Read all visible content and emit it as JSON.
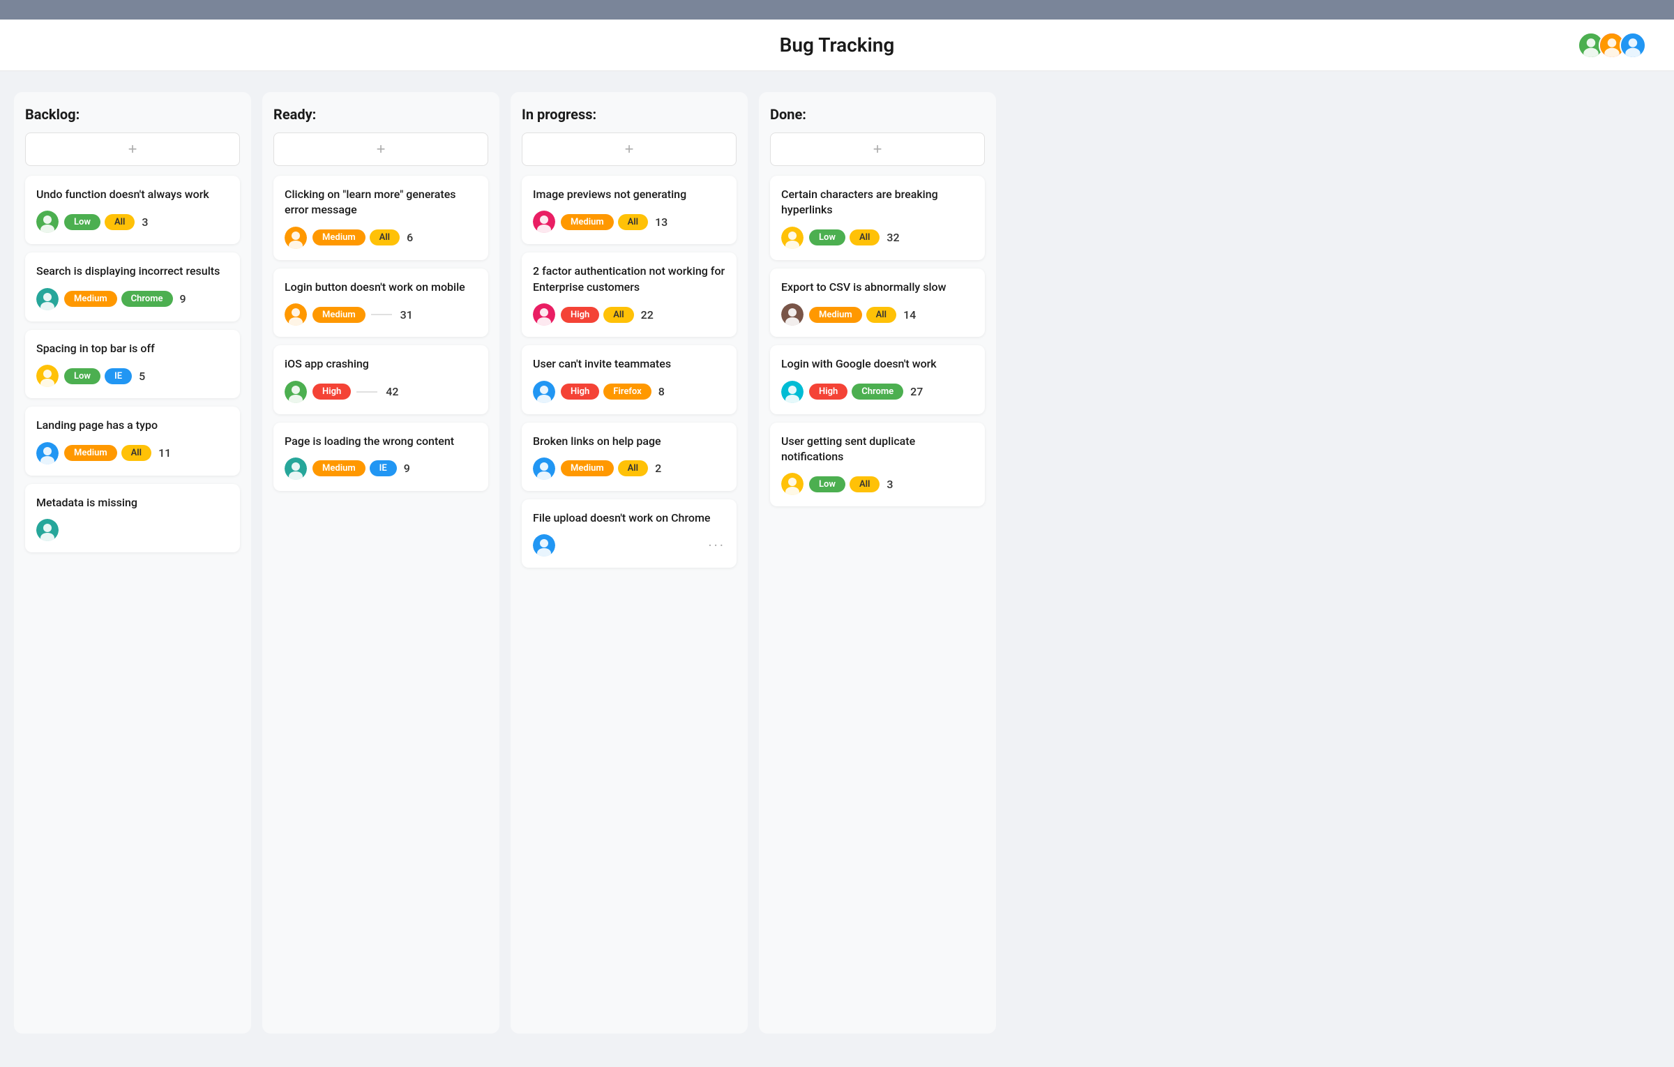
{
  "topBar": {},
  "header": {
    "title": "Bug Tracking",
    "avatars": [
      {
        "color": "#4caf50",
        "label": "user1",
        "emoji": "👩"
      },
      {
        "color": "#ff9800",
        "label": "user2",
        "emoji": "👱"
      },
      {
        "color": "#2196f3",
        "label": "user3",
        "emoji": "👦"
      }
    ]
  },
  "addButtonLabel": "+",
  "columns": [
    {
      "id": "backlog",
      "title": "Backlog:",
      "cards": [
        {
          "title": "Undo function doesn't always work",
          "avatarColor": "#4caf50",
          "avatarEmoji": "🧑",
          "priority": "Low",
          "priorityClass": "tag-low",
          "platform": "All",
          "platformClass": "tag-all",
          "count": "3"
        },
        {
          "title": "Search is displaying incorrect results",
          "avatarColor": "#26a69a",
          "avatarEmoji": "🧑",
          "priority": "Medium",
          "priorityClass": "tag-medium",
          "platform": "Chrome",
          "platformClass": "tag-chrome",
          "count": "9"
        },
        {
          "title": "Spacing in top bar is off",
          "avatarColor": "#ffc107",
          "avatarEmoji": "🧑",
          "priority": "Low",
          "priorityClass": "tag-low",
          "platform": "IE",
          "platformClass": "tag-ie",
          "count": "5"
        },
        {
          "title": "Landing page has a typo",
          "avatarColor": "#2196f3",
          "avatarEmoji": "🧑",
          "priority": "Medium",
          "priorityClass": "tag-medium",
          "platform": "All",
          "platformClass": "tag-all",
          "count": "11"
        },
        {
          "title": "Metadata is missing",
          "avatarColor": "#26a69a",
          "avatarEmoji": "🧑",
          "priority": null,
          "platform": null,
          "count": null
        }
      ]
    },
    {
      "id": "ready",
      "title": "Ready:",
      "cards": [
        {
          "title": "Clicking on \"learn more\" generates error message",
          "avatarColor": "#ff9800",
          "avatarEmoji": "🧑",
          "priority": "Medium",
          "priorityClass": "tag-medium",
          "platform": "All",
          "platformClass": "tag-all",
          "count": "6"
        },
        {
          "title": "Login button doesn't work on mobile",
          "avatarColor": "#ff9800",
          "avatarEmoji": "🧑",
          "priority": "Medium",
          "priorityClass": "tag-medium",
          "platform": null,
          "platformClass": null,
          "count": "31",
          "showDivider": true
        },
        {
          "title": "iOS app crashing",
          "avatarColor": "#4caf50",
          "avatarEmoji": "🧑",
          "priority": "High",
          "priorityClass": "tag-high",
          "platform": null,
          "platformClass": null,
          "count": "42",
          "showDivider": true
        },
        {
          "title": "Page is loading the wrong content",
          "avatarColor": "#26a69a",
          "avatarEmoji": "🧑",
          "priority": "Medium",
          "priorityClass": "tag-medium",
          "platform": "IE",
          "platformClass": "tag-ie",
          "count": "9"
        }
      ]
    },
    {
      "id": "inprogress",
      "title": "In progress:",
      "cards": [
        {
          "title": "Image previews not generating",
          "avatarColor": "#e91e63",
          "avatarEmoji": "🧑",
          "priority": "Medium",
          "priorityClass": "tag-medium",
          "platform": "All",
          "platformClass": "tag-all",
          "count": "13"
        },
        {
          "title": "2 factor authentication not working for Enterprise customers",
          "avatarColor": "#e91e63",
          "avatarEmoji": "🧑",
          "priority": "High",
          "priorityClass": "tag-high",
          "platform": "All",
          "platformClass": "tag-all",
          "count": "22"
        },
        {
          "title": "User can't invite teammates",
          "avatarColor": "#2196f3",
          "avatarEmoji": "🧑",
          "priority": "High",
          "priorityClass": "tag-high",
          "platform": "Firefox",
          "platformClass": "tag-firefox",
          "count": "8"
        },
        {
          "title": "Broken links on help page",
          "avatarColor": "#2196f3",
          "avatarEmoji": "🧑",
          "priority": "Medium",
          "priorityClass": "tag-medium",
          "platform": "All",
          "platformClass": "tag-all",
          "count": "2"
        },
        {
          "title": "File upload doesn't work on Chrome",
          "avatarColor": "#2196f3",
          "avatarEmoji": "🧑",
          "priority": null,
          "platform": null,
          "count": null,
          "showDots": true
        }
      ]
    },
    {
      "id": "done",
      "title": "Done:",
      "cards": [
        {
          "title": "Certain characters are breaking hyperlinks",
          "avatarColor": "#ffc107",
          "avatarEmoji": "🧑",
          "priority": "Low",
          "priorityClass": "tag-low",
          "platform": "All",
          "platformClass": "tag-all",
          "count": "32"
        },
        {
          "title": "Export to CSV is abnormally slow",
          "avatarColor": "#795548",
          "avatarEmoji": "🧑",
          "priority": "Medium",
          "priorityClass": "tag-medium",
          "platform": "All",
          "platformClass": "tag-all",
          "count": "14"
        },
        {
          "title": "Login with Google doesn't work",
          "avatarColor": "#00bcd4",
          "avatarEmoji": "🧑",
          "priority": "High",
          "priorityClass": "tag-high",
          "platform": "Chrome",
          "platformClass": "tag-chrome",
          "count": "27"
        },
        {
          "title": "User getting sent duplicate notifications",
          "avatarColor": "#ffc107",
          "avatarEmoji": "🧑",
          "priority": "Low",
          "priorityClass": "tag-low",
          "platform": "All",
          "platformClass": "tag-all",
          "count": "3"
        }
      ]
    }
  ]
}
